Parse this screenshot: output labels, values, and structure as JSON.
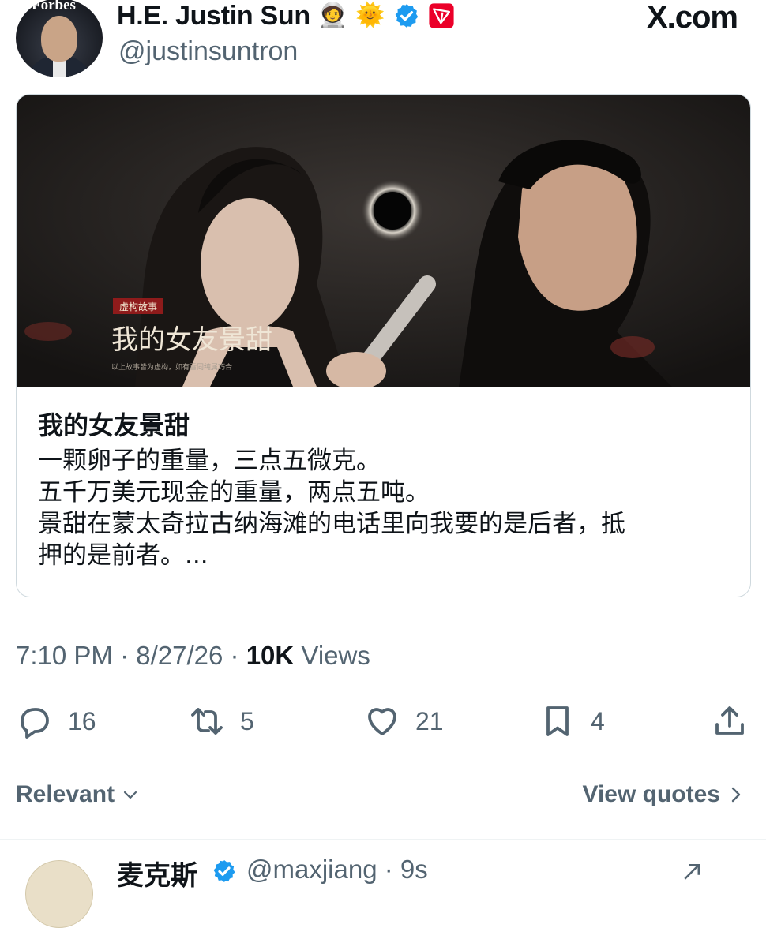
{
  "post": {
    "author": {
      "name": "H.E. Justin Sun",
      "emojis": [
        "🧑‍🚀",
        "🌞"
      ],
      "handle": "@justinsuntron",
      "avatar_text": "Forbes"
    },
    "site": "X.com",
    "card": {
      "image_badge": "虚构故事",
      "image_title": "我的女友景甜",
      "image_caption": "以上故事皆为虚构，如有雷同纯属巧合",
      "title": "我的女友景甜",
      "lines": [
        "一颗卵子的重量，三点五微克。",
        "五千万美元现金的重量，两点五吨。",
        "景甜在蒙太奇拉古纳海滩的电话里向我要的是后者，抵",
        "押的是前者。..."
      ]
    },
    "meta": {
      "time": "7:10 PM",
      "sep1": "·",
      "date": "8/27/26",
      "sep2": "·",
      "views_count": "10K",
      "views_label": "Views"
    },
    "actions": {
      "replies": "16",
      "reposts": "5",
      "likes": "21",
      "bookmarks": "4"
    }
  },
  "sort": {
    "label": "Relevant",
    "quotes_label": "View quotes"
  },
  "reply": {
    "name": "麦克斯",
    "handle": "@maxjiang · 9s"
  },
  "colors": {
    "text": "#0f1419",
    "muted": "#536471",
    "border": "#cfd9de",
    "verified": "#1d9bf0",
    "tron": "#eb0029"
  }
}
